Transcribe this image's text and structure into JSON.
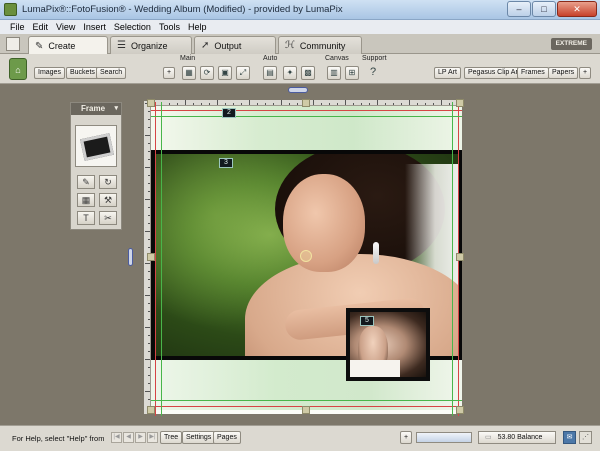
{
  "window": {
    "title": "LumaPix®::FotoFusion® - Wedding Album (Modified) - provided by LumaPix",
    "minimize": "–",
    "maximize": "□",
    "close": "✕"
  },
  "menu": [
    "File",
    "Edit",
    "View",
    "Insert",
    "Selection",
    "Tools",
    "Help"
  ],
  "tabs": [
    {
      "label": "Create",
      "icon": "create-icon",
      "glyph": "✎"
    },
    {
      "label": "Organize",
      "icon": "organize-icon",
      "glyph": "☰"
    },
    {
      "label": "Output",
      "icon": "output-icon",
      "glyph": "➚"
    },
    {
      "label": "Community",
      "icon": "community-icon",
      "glyph": "ℋ"
    }
  ],
  "edition_badge": "EXTREME",
  "toolbar": {
    "left_buttons": [
      "Images",
      "Buckets",
      "Search"
    ],
    "add_symbol": "+",
    "groups": [
      "Main",
      "Auto",
      "Canvas",
      "Support"
    ],
    "help_symbol": "?",
    "right_buttons": [
      "LP Art",
      "Pegasus Clip Art",
      "Frames",
      "Papers"
    ]
  },
  "frame_panel": {
    "title": "Frame",
    "close": "▾",
    "tools": [
      "✎",
      "↻",
      "▦",
      "⚒",
      "T",
      "✂"
    ]
  },
  "canvas": {
    "frame_labels": [
      "2",
      "3",
      "5"
    ]
  },
  "statusbar": {
    "help_text": "For Help, select \"Help\" from",
    "nav": [
      "|◀",
      "◀",
      "▶",
      "▶|"
    ],
    "buttons": [
      "Tree",
      "Settings",
      "Pages"
    ],
    "add_symbol": "+",
    "progress": 0.0,
    "balance": "53.80 Balance"
  },
  "colors": {
    "workspace": "#7d776a",
    "accent": "#4c78a8",
    "guide_red": "#d64545",
    "guide_green": "#49b54a"
  }
}
